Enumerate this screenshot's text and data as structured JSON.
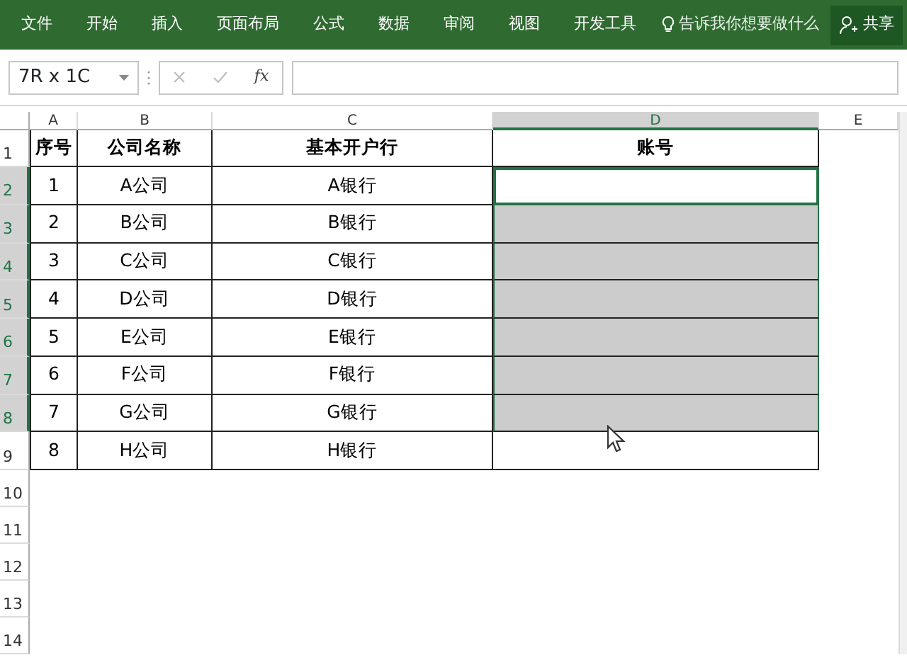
{
  "ribbon": {
    "tabs": [
      {
        "label": "文件"
      },
      {
        "label": "开始"
      },
      {
        "label": "插入"
      },
      {
        "label": "页面布局"
      },
      {
        "label": "公式"
      },
      {
        "label": "数据"
      },
      {
        "label": "审阅"
      },
      {
        "label": "视图"
      },
      {
        "label": "开发工具"
      }
    ],
    "tell_me": "告诉我你想要做什么",
    "share": "共享"
  },
  "formula_bar": {
    "name_box": "7R x 1C",
    "fx": "fx"
  },
  "columns": [
    {
      "label": "A",
      "selected": false
    },
    {
      "label": "B",
      "selected": false
    },
    {
      "label": "C",
      "selected": false
    },
    {
      "label": "D",
      "selected": true
    },
    {
      "label": "E",
      "selected": false
    }
  ],
  "rows": [
    {
      "header": "1",
      "selected": false,
      "cells": [
        "序号",
        "公司名称",
        "基本开户行",
        "账号"
      ]
    },
    {
      "header": "2",
      "selected": true,
      "active": true,
      "cells": [
        "1",
        "A公司",
        "A银行"
      ]
    },
    {
      "header": "3",
      "selected": true,
      "active": false,
      "cells": [
        "2",
        "B公司",
        "B银行"
      ]
    },
    {
      "header": "4",
      "selected": true,
      "active": false,
      "cells": [
        "3",
        "C公司",
        "C银行"
      ]
    },
    {
      "header": "5",
      "selected": true,
      "active": false,
      "cells": [
        "4",
        "D公司",
        "D银行"
      ]
    },
    {
      "header": "6",
      "selected": true,
      "active": false,
      "cells": [
        "5",
        "E公司",
        "E银行"
      ]
    },
    {
      "header": "7",
      "selected": true,
      "active": false,
      "cells": [
        "6",
        "F公司",
        "F银行"
      ]
    },
    {
      "header": "8",
      "selected": true,
      "active": false,
      "cells": [
        "7",
        "G公司",
        "G银行"
      ]
    },
    {
      "header": "9",
      "selected": false,
      "active": false,
      "cells": [
        "8",
        "H公司",
        "H银行"
      ]
    },
    {
      "header": "10",
      "selected": false,
      "cells": []
    },
    {
      "header": "11",
      "selected": false,
      "cells": []
    },
    {
      "header": "12",
      "selected": false,
      "cells": []
    },
    {
      "header": "13",
      "selected": false,
      "cells": []
    },
    {
      "header": "14",
      "selected": false,
      "cells": []
    }
  ]
}
